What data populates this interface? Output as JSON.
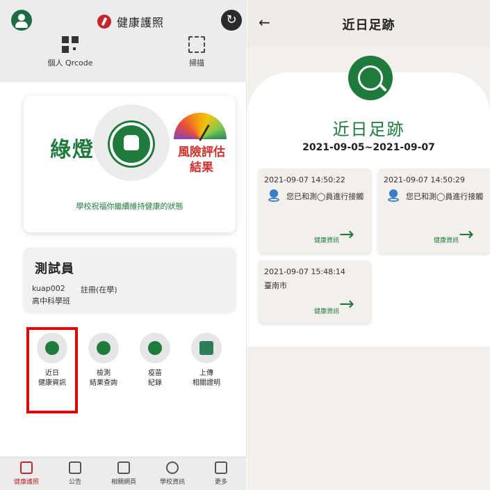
{
  "left": {
    "header": {
      "brand": "健康護照"
    },
    "qr": [
      {
        "label": "個人 Qrcode",
        "icon": "qrcode-icon"
      },
      {
        "label": "掃描",
        "icon": "scan-icon"
      }
    ],
    "status": {
      "light": "綠燈",
      "risk_line1": "風險評估",
      "risk_line2": "結果",
      "message": "學校祝福你繼續維持健康的狀態"
    },
    "user": {
      "name": "測試員",
      "id": "kuap002",
      "status": "註冊(在學)",
      "class": "高中科學班"
    },
    "functions": [
      {
        "line1": "近日",
        "line2": "健康資訊",
        "icon": "footprint-icon"
      },
      {
        "line1": "檢測",
        "line2": "結果查詢",
        "icon": "test-result-icon"
      },
      {
        "line1": "疫苗",
        "line2": "紀錄",
        "icon": "vaccine-icon"
      },
      {
        "line1": "上傳",
        "line2": "相關證明",
        "icon": "upload-certificate-icon"
      }
    ],
    "nav": [
      {
        "label": "健康護照",
        "icon": "passport-icon",
        "active": true
      },
      {
        "label": "公告",
        "icon": "megaphone-icon"
      },
      {
        "label": "相關網頁",
        "icon": "webpage-icon"
      },
      {
        "label": "學校資訊",
        "icon": "info-icon"
      },
      {
        "label": "更多",
        "icon": "more-grid-icon"
      }
    ]
  },
  "right": {
    "title": "近日足跡",
    "heading": "近日足跡",
    "range": "2021-09-05~2021-09-07",
    "cards": [
      {
        "time": "2021-09-07 14:50:22",
        "text": "您已和測◯員進行接觸",
        "link": "健康資訊",
        "icon": "contact-person-icon"
      },
      {
        "time": "2021-09-07 14:50:29",
        "text": "您已和測◯員進行接觸",
        "link": "健康資訊",
        "icon": "contact-person-icon"
      },
      {
        "time": "2021-09-07 15:48:14",
        "text": "臺南市",
        "link": "健康資訊"
      }
    ]
  },
  "colors": {
    "accent_green": "#1f7a3d",
    "alert_red": "#d0312d",
    "highlight_red": "#e00000"
  }
}
